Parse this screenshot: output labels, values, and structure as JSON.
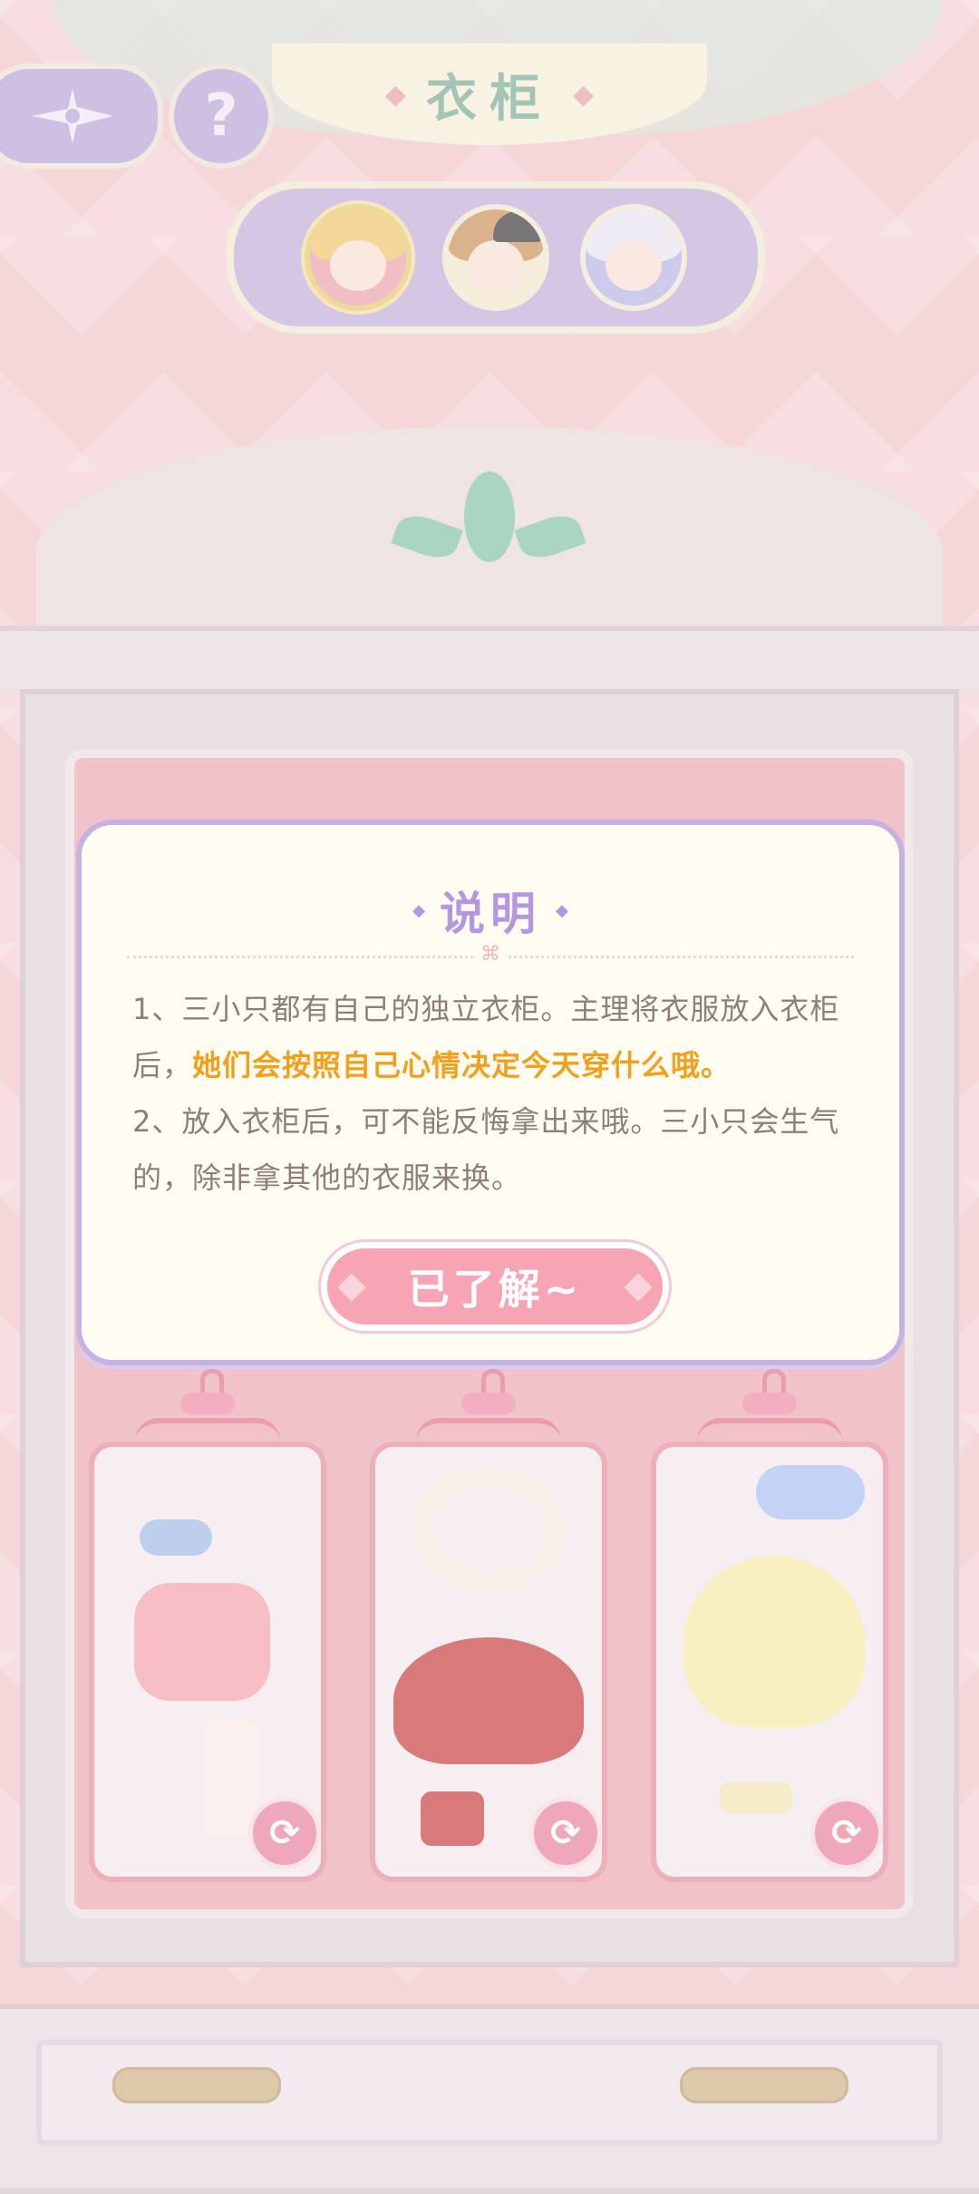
{
  "header": {
    "title": "衣柜",
    "back_icon": "compass-star-back-icon",
    "help_label": "?"
  },
  "characters": [
    {
      "name": "avatar-blonde-girl",
      "selected": true
    },
    {
      "name": "avatar-brown-hair-hat",
      "selected": false
    },
    {
      "name": "avatar-silver-hair",
      "selected": false
    }
  ],
  "dialog": {
    "title": "说明",
    "line1_prefix": "1、三小只都有自己的独立衣柜。主理将衣服放入衣柜后，",
    "line1_highlight": "她们会按照自己心情决定今天穿什么哦。",
    "line2": "2、放入衣柜后，可不能反悔拿出来哦。三小只会生气的，除非拿其他的衣服来换。",
    "confirm_label": "已了解~",
    "highlight_color": "#f2a01c",
    "accent_color": "#b497de"
  },
  "cards": [
    {
      "name": "outfit-card-pink-sweater",
      "refresh_icon": "refresh-icon"
    },
    {
      "name": "outfit-card-red-dress",
      "refresh_icon": "refresh-icon"
    },
    {
      "name": "outfit-card-yellow-dress",
      "refresh_icon": "refresh-icon"
    }
  ],
  "refresh_glyph": "⟳"
}
